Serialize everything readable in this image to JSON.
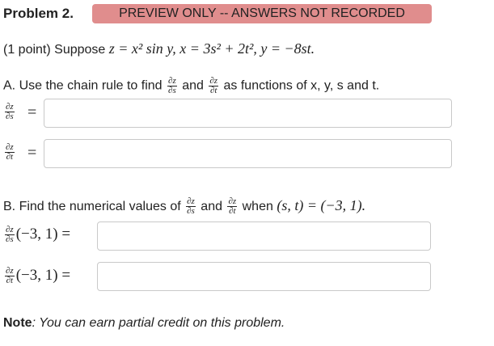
{
  "header": {
    "title": "Problem 2.",
    "badge": "PREVIEW ONLY -- ANSWERS NOT RECORDED"
  },
  "intro": {
    "points": "(1 point) Suppose",
    "equation": "z = x² sin y, x = 3s² + 2t², y = −8st."
  },
  "part_a": {
    "prefix": "A. Use the chain rule to find",
    "and": "and",
    "suffix": "as functions of x, y, s and t.",
    "dz": "∂z",
    "ds": "∂s",
    "dt": "∂t",
    "eq": "="
  },
  "part_b": {
    "prefix": "B. Find the numerical values of",
    "and": "and",
    "when": "when",
    "condition": "(s, t) = (−3, 1).",
    "arg": "(−3, 1) ="
  },
  "inputs": {
    "a1_value": "",
    "a2_value": "",
    "b1_value": "",
    "b2_value": ""
  },
  "note": {
    "label": "Note",
    "text": ": You can earn partial credit on this problem."
  }
}
